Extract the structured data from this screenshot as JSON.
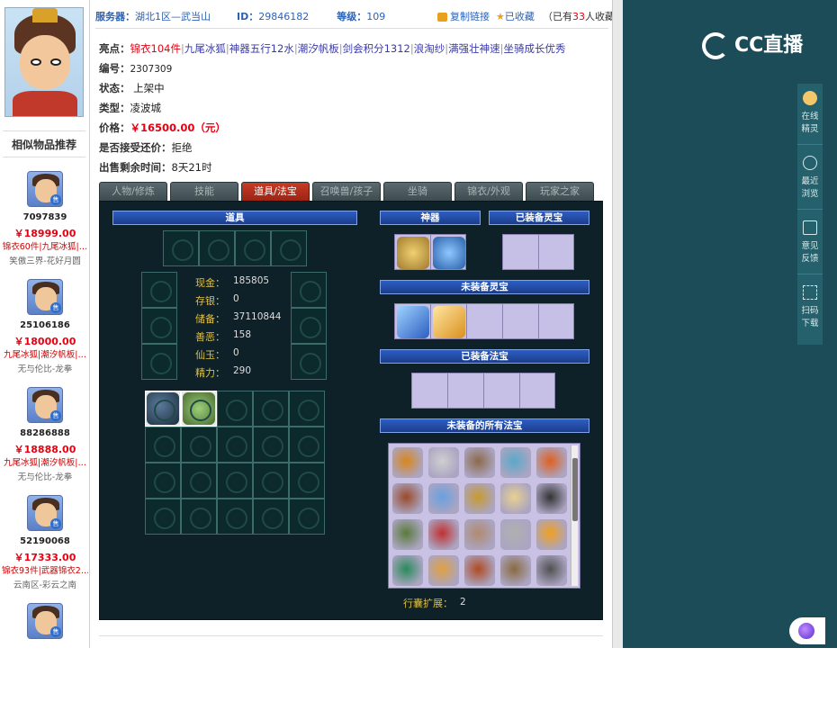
{
  "header": {
    "server_label": "服务器：",
    "server_value": "湖北1区—武当山",
    "id_label": "ID：",
    "id_value": "29846182",
    "level_label": "等级：",
    "level_value": "109",
    "copy_link": "复制链接",
    "favorited": "已收藏",
    "fav_count_prefix": "（已有",
    "fav_count": "33",
    "fav_count_suffix": "人收藏）"
  },
  "details": {
    "highlights_label": "亮点：",
    "highlights": [
      "锦衣104件",
      "九尾冰狐",
      "神器五行12水",
      "潮汐帆板",
      "剑会积分1312",
      "浪淘纱",
      "满强壮神速",
      "坐骑成长优秀"
    ],
    "number_label": "编号：",
    "number_value": "2307309",
    "status_label": "状态：",
    "status_value": "上架中",
    "type_label": "类型：",
    "type_value": "凌波城",
    "price_label": "价格：",
    "price_value": "￥16500.00（元）",
    "bargain_label": "是否接受还价：",
    "bargain_value": "拒绝",
    "remain_label": "出售剩余时间：",
    "remain_value": "8天21时"
  },
  "tabs": [
    "人物/修炼",
    "技能",
    "道具/法宝",
    "召唤兽/孩子",
    "坐骑",
    "锦衣/外观",
    "玩家之家"
  ],
  "active_tab": 2,
  "inventory": {
    "props_title": "道具",
    "artifact_title": "神器",
    "equipped_spirit_title": "已装备灵宝",
    "unequipped_spirit_title": "未装备灵宝",
    "equipped_fabao_title": "已装备法宝",
    "all_fabao_title": "未装备的所有法宝",
    "stats": [
      {
        "label": "现金：",
        "value": "185805"
      },
      {
        "label": "存银：",
        "value": "0"
      },
      {
        "label": "储备：",
        "value": "37110844"
      },
      {
        "label": "善恶：",
        "value": "158"
      },
      {
        "label": "仙玉：",
        "value": "0"
      },
      {
        "label": "精力：",
        "value": "290"
      }
    ],
    "bag_expand_label": "行囊扩展：",
    "bag_expand_value": "2"
  },
  "sidebar": {
    "title": "相似物品推荐",
    "items": [
      {
        "id": "7097839",
        "price": "￥18999.00",
        "highlights": "锦衣60件|九尾冰狐|…",
        "server": "笑傲三界-花好月圆"
      },
      {
        "id": "25106186",
        "price": "￥18000.00",
        "highlights": "九尾冰狐|潮汐帆板|…",
        "server": "无与伦比-龙拳"
      },
      {
        "id": "88286888",
        "price": "￥18888.00",
        "highlights": "九尾冰狐|潮汐帆板|…",
        "server": "无与伦比-龙拳"
      },
      {
        "id": "52190068",
        "price": "￥17333.00",
        "highlights": "锦衣93件|武器锦衣2…",
        "server": "云南区-彩云之南"
      }
    ]
  },
  "right_panel": {
    "logo": "CC直播",
    "nav": [
      "在线精灵",
      "最近浏览",
      "意见反馈",
      "扫码下载"
    ]
  },
  "colors": {
    "price_red": "#e60012",
    "link_blue": "#2b62b6",
    "panel_bg": "#0f2128",
    "active_tab": "#c83b25",
    "right_bg": "#1b4c57"
  }
}
